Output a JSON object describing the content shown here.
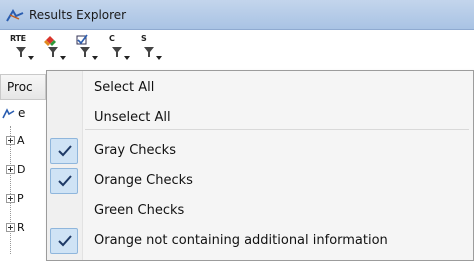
{
  "window": {
    "title": "Results Explorer"
  },
  "toolbar": {
    "buttons": [
      {
        "label": "RTE",
        "icon": "rte-filter-icon"
      },
      {
        "label": "",
        "icon": "color-diamond-filter-icon"
      },
      {
        "label": "",
        "icon": "checkbox-filter-icon"
      },
      {
        "label": "C",
        "icon": "c-filter-icon"
      },
      {
        "label": "S",
        "icon": "s-filter-icon"
      }
    ]
  },
  "panel": {
    "column_header": "Proc",
    "root_label": "e",
    "tree_items": [
      "A",
      "D",
      "P",
      "R"
    ]
  },
  "menu": {
    "items": [
      {
        "label": "Select All",
        "checked": false
      },
      {
        "label": "Unselect All",
        "checked": false
      },
      {
        "label": "Gray Checks",
        "checked": true
      },
      {
        "label": "Orange Checks",
        "checked": true
      },
      {
        "label": "Green Checks",
        "checked": false
      },
      {
        "label": "Orange not containing additional information",
        "checked": true
      }
    ]
  },
  "colors": {
    "titlebar": "#b7cdea",
    "check_bg": "#cfe3f5",
    "check_border": "#8fb6dc",
    "checkmark": "#1f3a66"
  }
}
